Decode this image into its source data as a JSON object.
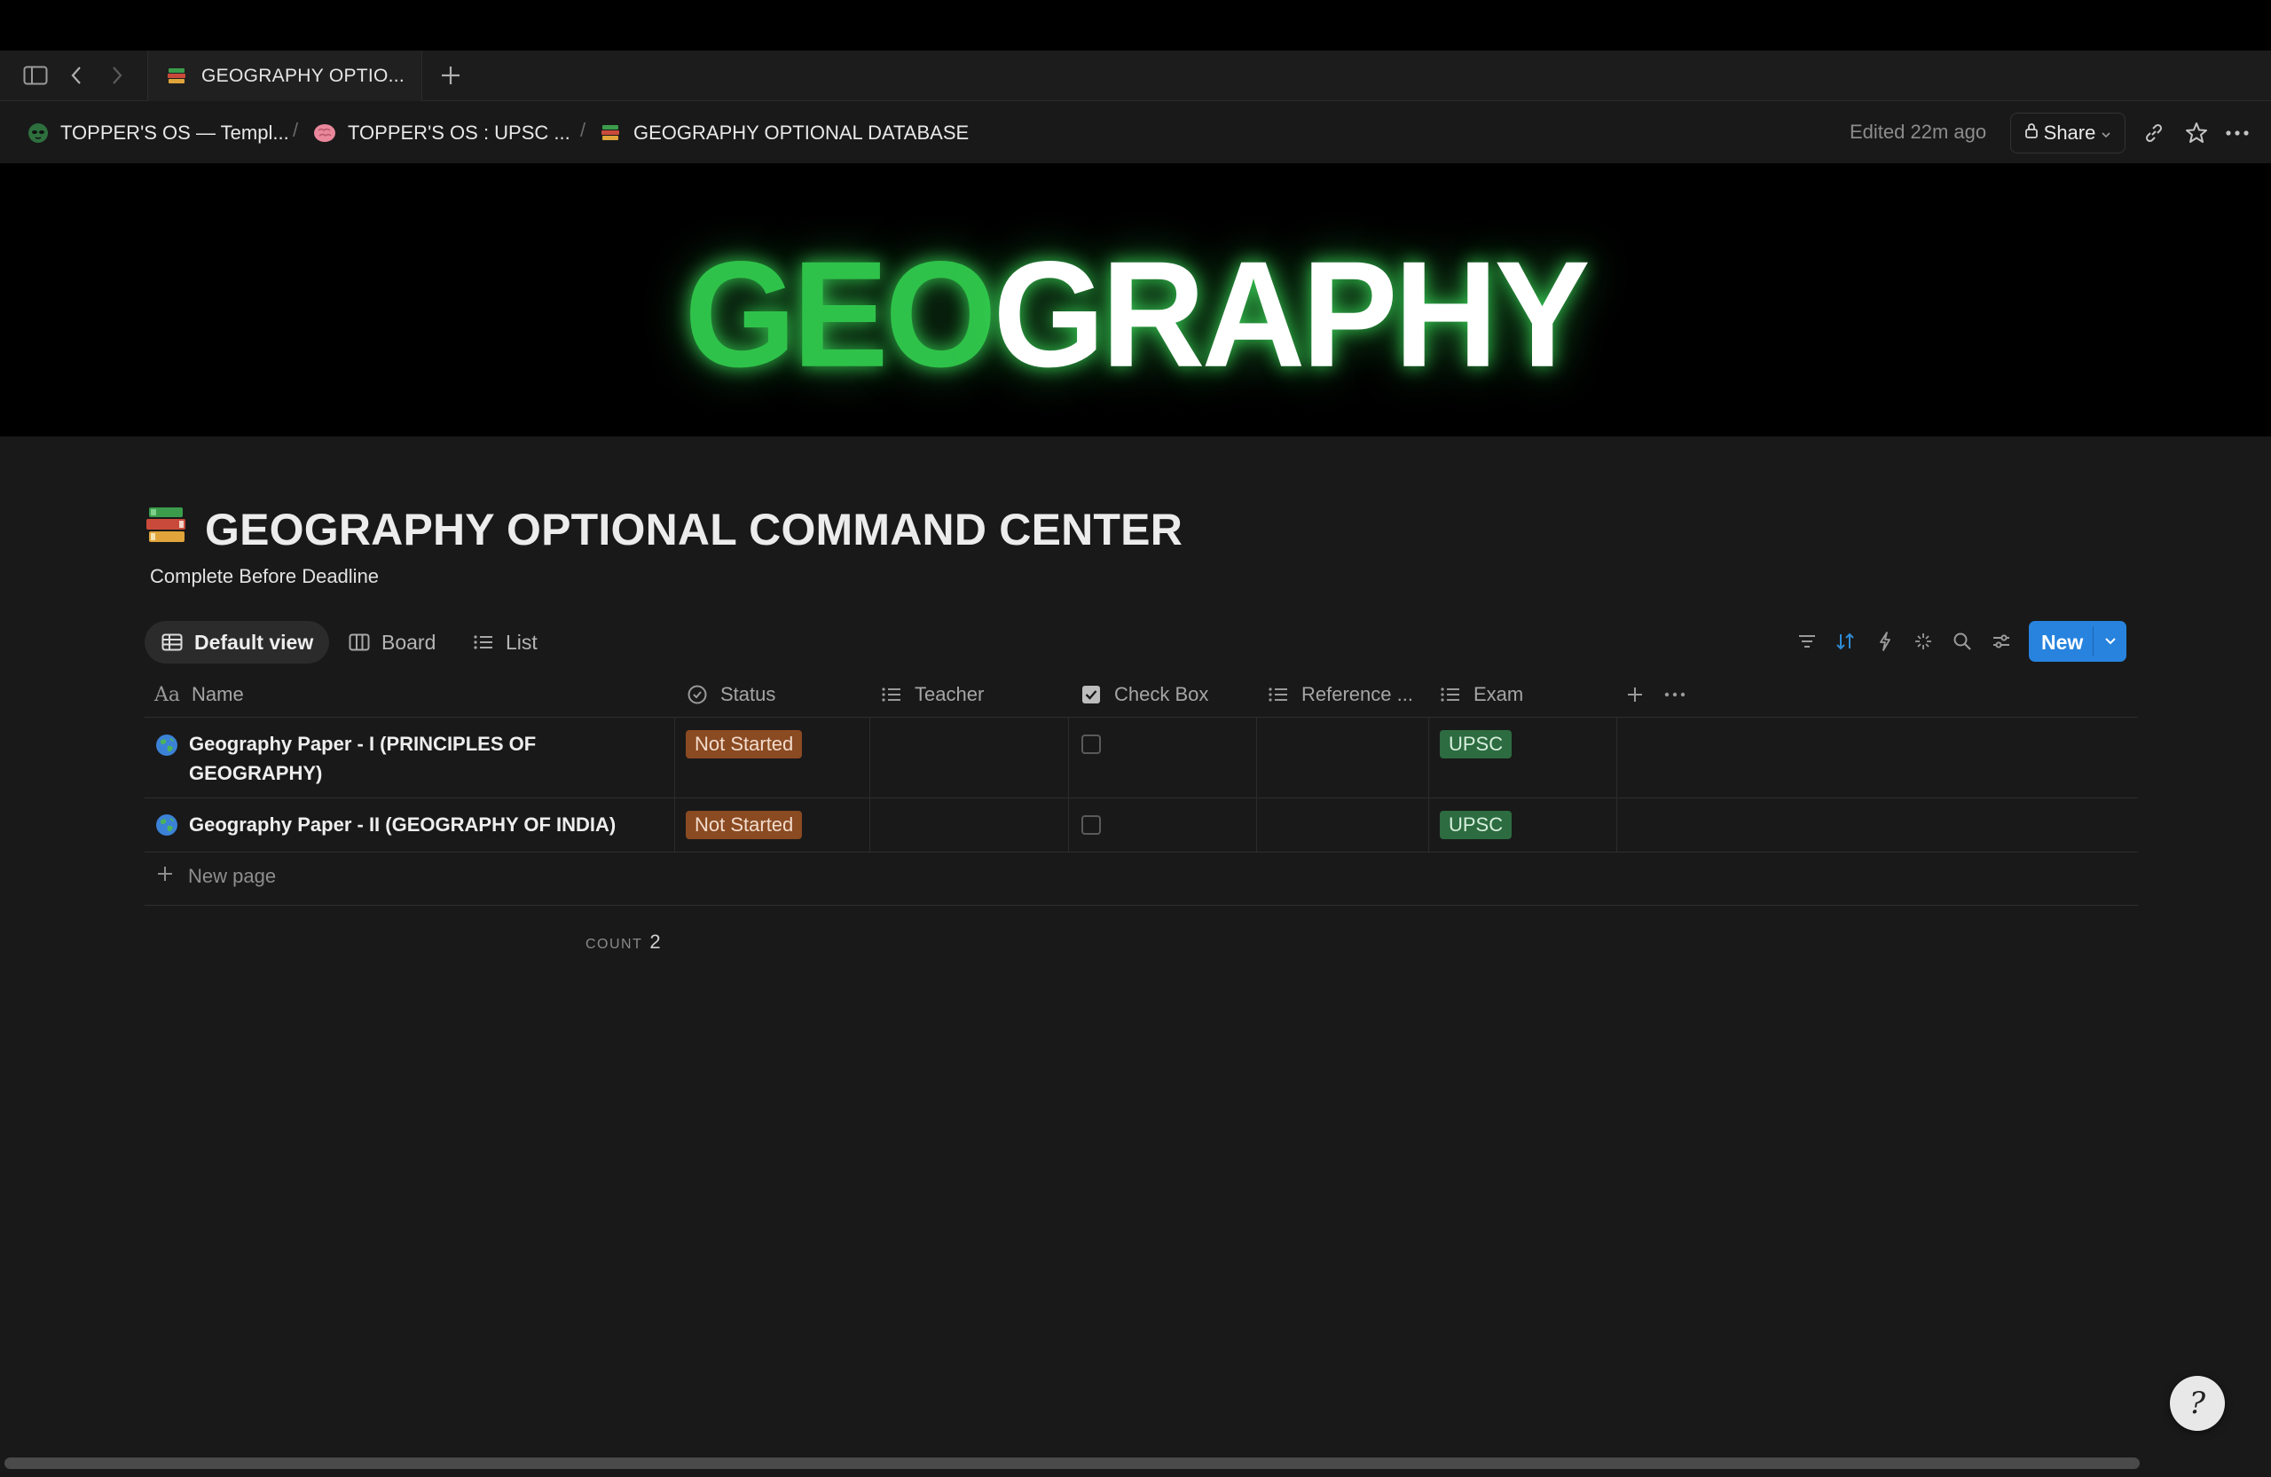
{
  "tab": {
    "title": "GEOGRAPHY OPTIO...",
    "icon": "books-icon"
  },
  "breadcrumb": [
    {
      "label": "TOPPER'S OS — Templ...",
      "icon": "alien-icon"
    },
    {
      "label": "TOPPER'S OS : UPSC ...",
      "icon": "brain-icon"
    },
    {
      "label": "GEOGRAPHY OPTIONAL DATABASE",
      "icon": "books-icon"
    }
  ],
  "breadcrumb_separator": "/",
  "header": {
    "edited": "Edited 22m ago",
    "share_label": "Share"
  },
  "cover": {
    "title_green": "GEO",
    "title_white": "GRAPHY",
    "accent_color": "#2fc24a"
  },
  "page": {
    "title": "GEOGRAPHY OPTIONAL COMMAND CENTER",
    "subtitle": "Complete Before Deadline",
    "icon": "books-icon"
  },
  "views": [
    {
      "label": "Default view",
      "icon": "table-icon",
      "active": true
    },
    {
      "label": "Board",
      "icon": "board-icon",
      "active": false
    },
    {
      "label": "List",
      "icon": "list-icon",
      "active": false
    }
  ],
  "toolbar": {
    "new_label": "New"
  },
  "columns": [
    {
      "label": "Name",
      "icon": "text-icon"
    },
    {
      "label": "Status",
      "icon": "status-icon"
    },
    {
      "label": "Teacher",
      "icon": "list-icon"
    },
    {
      "label": "Check Box",
      "icon": "checkbox-icon"
    },
    {
      "label": "Reference ...",
      "icon": "list-icon"
    },
    {
      "label": "Exam",
      "icon": "list-icon"
    }
  ],
  "rows": [
    {
      "name_line1": "Geography Paper - I (PRINCIPLES OF",
      "name_line2": "GEOGRAPHY)",
      "status": "Not Started",
      "teacher": "",
      "checked": false,
      "reference": "",
      "exam": "UPSC"
    },
    {
      "name_line1": "Geography Paper - II (GEOGRAPHY OF INDIA)",
      "name_line2": "",
      "status": "Not Started",
      "teacher": "",
      "checked": false,
      "reference": "",
      "exam": "UPSC"
    }
  ],
  "new_page_label": "New page",
  "footer": {
    "count_label": "COUNT",
    "count_value": "2"
  },
  "colors": {
    "status_not_started": "#8a4a22",
    "exam_upsc": "#2d6b40",
    "new_button": "#2783de",
    "background": "#191919"
  }
}
